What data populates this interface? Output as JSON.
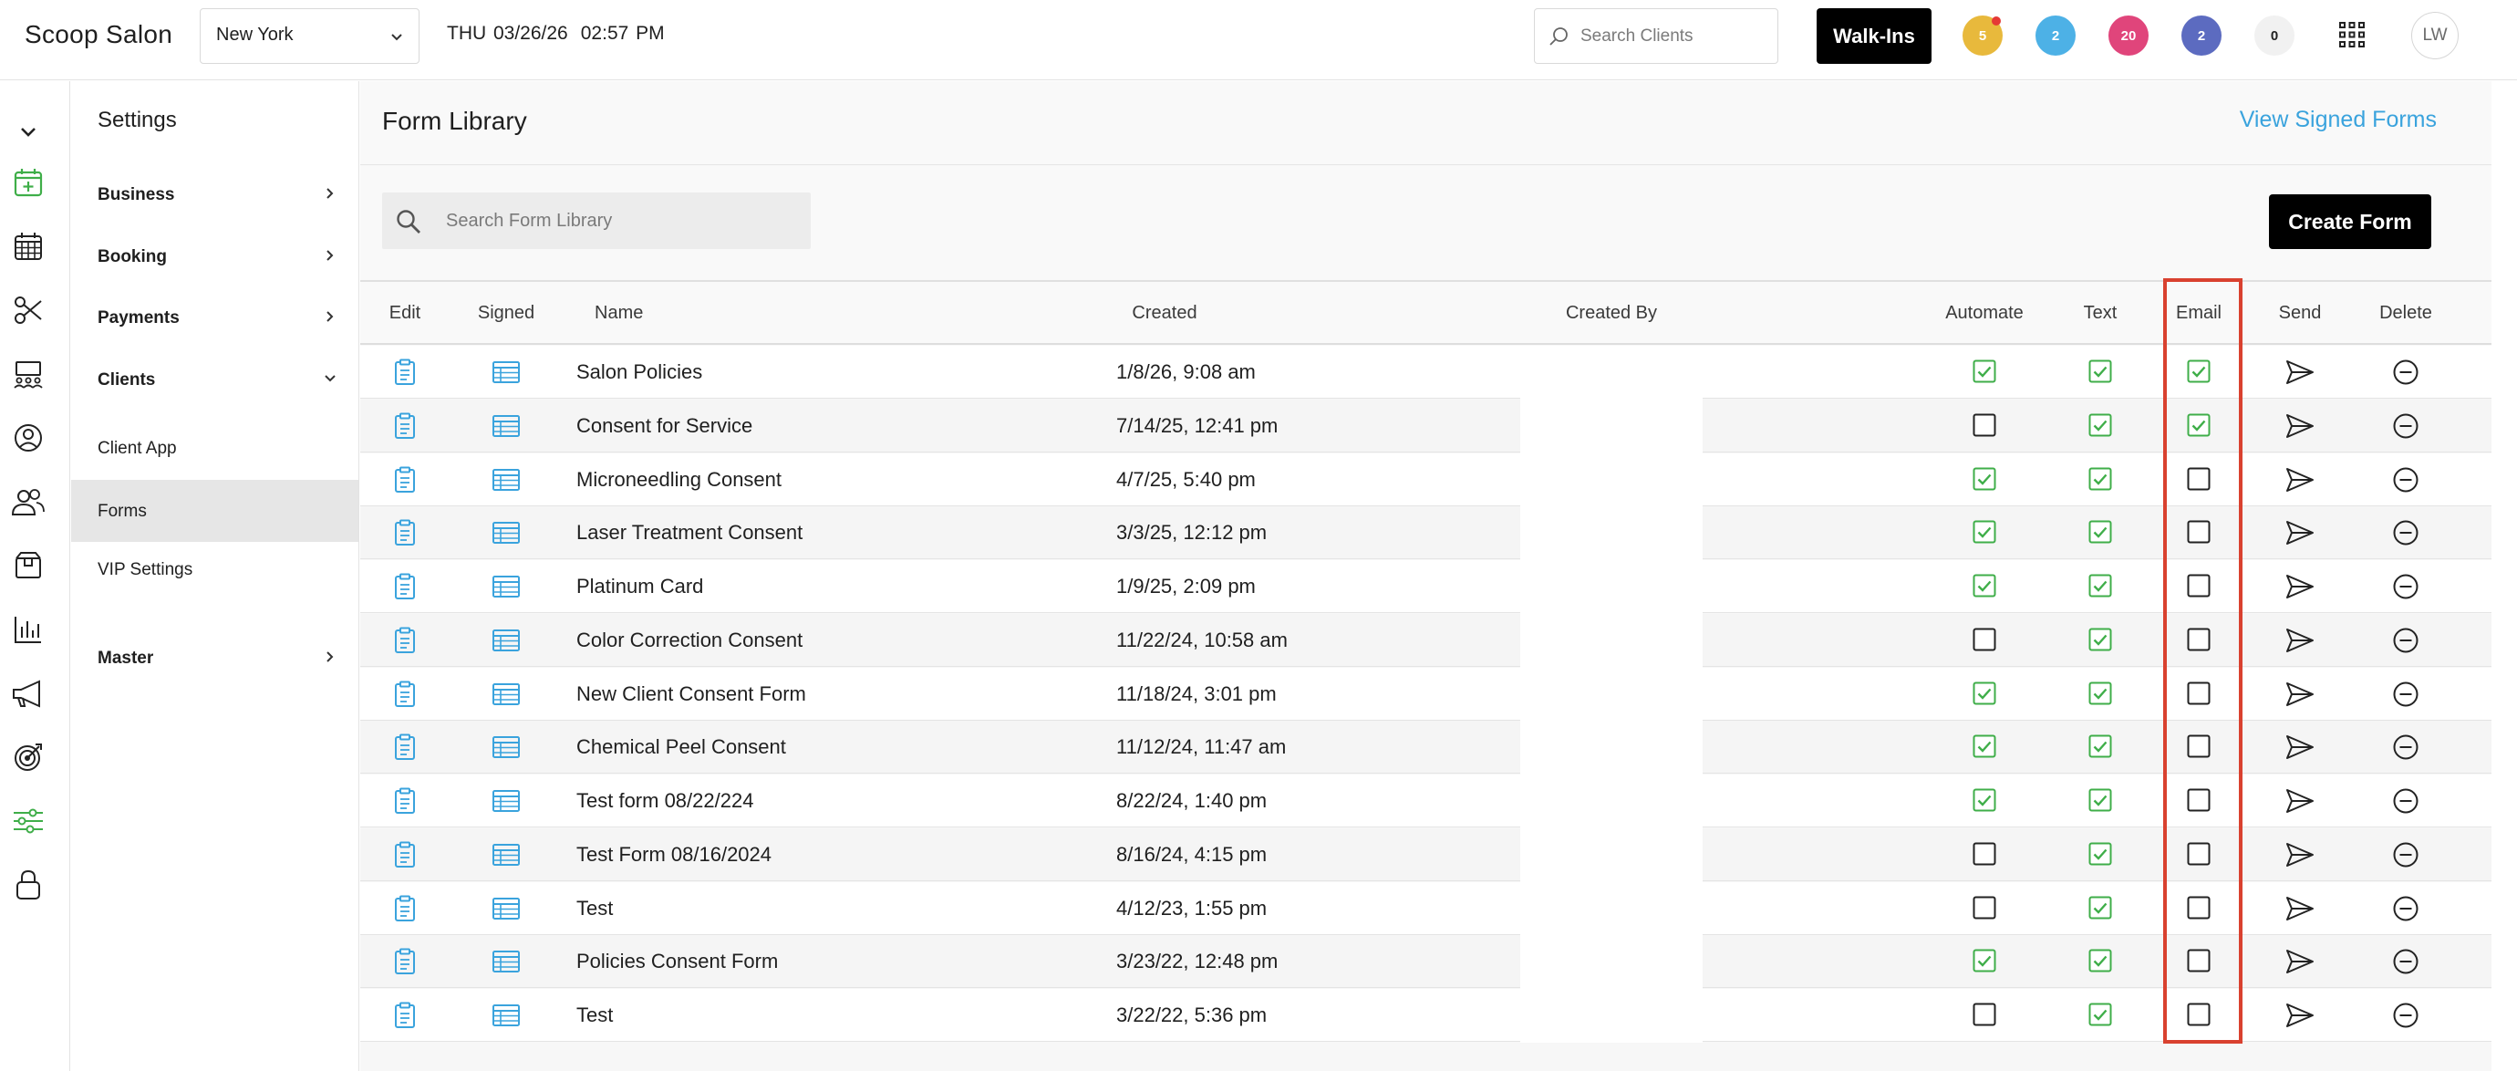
{
  "app": {
    "name": "Scoop Salon"
  },
  "header": {
    "location": "New York",
    "date": "THU 03/26/26",
    "time": "02:57 PM",
    "search_placeholder": "Search Clients",
    "walkins_label": "Walk-Ins",
    "badges": [
      {
        "value": "5",
        "color": "#e8b93c",
        "alert_dot": true
      },
      {
        "value": "2",
        "color": "#4db1e6",
        "alert_dot": false
      },
      {
        "value": "20",
        "color": "#e0457b",
        "alert_dot": false
      },
      {
        "value": "2",
        "color": "#5c6bc0",
        "alert_dot": false
      },
      {
        "value": "0",
        "color": "#f1f1f1",
        "alert_dot": false
      }
    ],
    "avatar_initials": "LW"
  },
  "rail": {
    "icons": [
      "collapse-chevron-icon",
      "calendar-add-icon",
      "calendar-grid-icon",
      "scissors-icon",
      "meeting-room-icon",
      "person-circle-icon",
      "people-icon",
      "package-icon",
      "bar-chart-icon",
      "megaphone-icon",
      "target-icon",
      "sliders-icon",
      "lock-icon"
    ],
    "active_icon": "sliders-icon",
    "accent_color": "#3fae49"
  },
  "settings": {
    "title": "Settings",
    "items": [
      {
        "label": "Business",
        "bold": true,
        "arrow": "right"
      },
      {
        "label": "Booking",
        "bold": true,
        "arrow": "right"
      },
      {
        "label": "Payments",
        "bold": true,
        "arrow": "right"
      },
      {
        "label": "Clients",
        "bold": true,
        "arrow": "down"
      },
      {
        "label": "Client App",
        "bold": false,
        "arrow": ""
      },
      {
        "label": "Forms",
        "bold": false,
        "arrow": "",
        "active": true
      },
      {
        "label": "VIP Settings",
        "bold": false,
        "arrow": ""
      },
      {
        "label": "Master",
        "bold": true,
        "arrow": "right"
      }
    ]
  },
  "main": {
    "title": "Form Library",
    "view_signed_label": "View Signed Forms",
    "search_placeholder": "Search Form Library",
    "create_label": "Create Form"
  },
  "table": {
    "columns": [
      "Edit",
      "Signed",
      "Name",
      "Created",
      "Created By",
      "Automate",
      "Text",
      "Email",
      "Send",
      "Delete"
    ],
    "rows": [
      {
        "name": "Salon Policies",
        "created": "1/8/26, 9:08 am",
        "created_by": "",
        "automate": true,
        "text": true,
        "email": true
      },
      {
        "name": "Consent for Service",
        "created": "7/14/25, 12:41 pm",
        "created_by": "",
        "automate": false,
        "text": true,
        "email": true
      },
      {
        "name": "Microneedling Consent",
        "created": "4/7/25, 5:40 pm",
        "created_by": "",
        "automate": true,
        "text": true,
        "email": false
      },
      {
        "name": "Laser Treatment Consent",
        "created": "3/3/25, 12:12 pm",
        "created_by": "",
        "automate": true,
        "text": true,
        "email": false
      },
      {
        "name": "Platinum Card",
        "created": "1/9/25, 2:09 pm",
        "created_by": "",
        "automate": true,
        "text": true,
        "email": false
      },
      {
        "name": "Color Correction Consent",
        "created": "11/22/24, 10:58 am",
        "created_by": "",
        "automate": false,
        "text": true,
        "email": false
      },
      {
        "name": "New Client Consent Form",
        "created": "11/18/24, 3:01 pm",
        "created_by": "",
        "automate": true,
        "text": true,
        "email": false
      },
      {
        "name": "Chemical Peel Consent",
        "created": "11/12/24, 11:47 am",
        "created_by": "",
        "automate": true,
        "text": true,
        "email": false
      },
      {
        "name": "Test form 08/22/224",
        "created": "8/22/24, 1:40 pm",
        "created_by": "",
        "automate": true,
        "text": true,
        "email": false
      },
      {
        "name": "Test Form 08/16/2024",
        "created": "8/16/24, 4:15 pm",
        "created_by": "",
        "automate": false,
        "text": true,
        "email": false
      },
      {
        "name": "Test",
        "created": "4/12/23, 1:55 pm",
        "created_by": "",
        "automate": false,
        "text": true,
        "email": false
      },
      {
        "name": "Policies Consent Form",
        "created": "3/23/22, 12:48 pm",
        "created_by": "",
        "automate": true,
        "text": true,
        "email": false
      },
      {
        "name": "Test",
        "created": "3/22/22, 5:36 pm",
        "created_by": "",
        "automate": false,
        "text": true,
        "email": false
      }
    ]
  },
  "colors": {
    "link_blue": "#3aa3dd",
    "check_green": "#3fae49",
    "highlight_red": "#d9412f",
    "icon_blue": "#3aa3dd"
  }
}
